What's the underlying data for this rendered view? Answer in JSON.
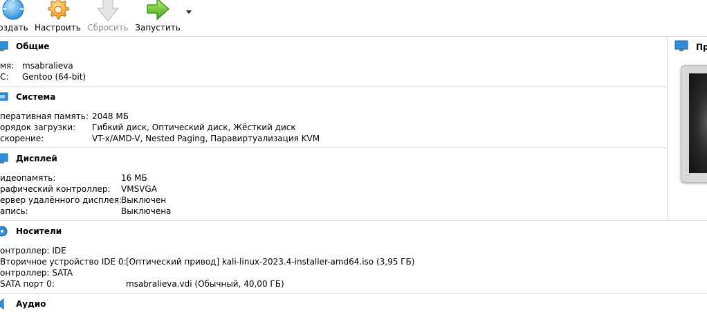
{
  "toolbar": {
    "buttons": [
      {
        "label": "оздать",
        "icon": "new-machine-icon",
        "enabled": true
      },
      {
        "label": "Настроить",
        "icon": "settings-gear-icon",
        "enabled": true
      },
      {
        "label": "Сбросить",
        "icon": "discard-icon",
        "enabled": false
      },
      {
        "label": "Запустить",
        "icon": "start-arrow-icon",
        "enabled": true
      }
    ],
    "dropdown_icon": "dropdown-triangle-icon"
  },
  "general": {
    "title": "Общие",
    "name_key": "мя:",
    "name_value": "msabralieva",
    "os_key": "С:",
    "os_value": "Gentoo (64-bit)"
  },
  "system": {
    "title": "Система",
    "rows": [
      {
        "k": "перативная память:",
        "v": "2048 МБ"
      },
      {
        "k": "орядок загрузки:",
        "v": "Гибкий диск, Оптический диск, Жёсткий диск"
      },
      {
        "k": "скорение:",
        "v": "VT-x/AMD-V, Nested Paging, Паравиртуализация KVM"
      }
    ]
  },
  "display": {
    "title": "Дисплей",
    "rows": [
      {
        "k": "идеопамять:",
        "v": "16 МБ"
      },
      {
        "k": "рафический контроллер:",
        "v": "VMSVGA"
      },
      {
        "k": "ервер удалённого дисплея:",
        "v": "Выключен"
      },
      {
        "k": "апись:",
        "v": "Выключена"
      }
    ]
  },
  "storage": {
    "title": "Носители",
    "rows": [
      {
        "k": "онтроллер: IDE",
        "v": ""
      },
      {
        "k": " Вторичное устройство IDE 0:",
        "v": "[Оптический привод] kali-linux-2023.4-installer-amd64.iso (3,95 ГБ)"
      },
      {
        "k": "онтроллер: SATA",
        "v": ""
      },
      {
        "k": " SATA порт 0:",
        "v": "msabralieva.vdi (Обычный, 40,00 ГБ)"
      }
    ]
  },
  "audio": {
    "title": "Аудио"
  },
  "preview": {
    "title": "Пр"
  },
  "colors": {
    "accent_blue": "#2e8fd8",
    "separator": "#dcdcdc"
  }
}
